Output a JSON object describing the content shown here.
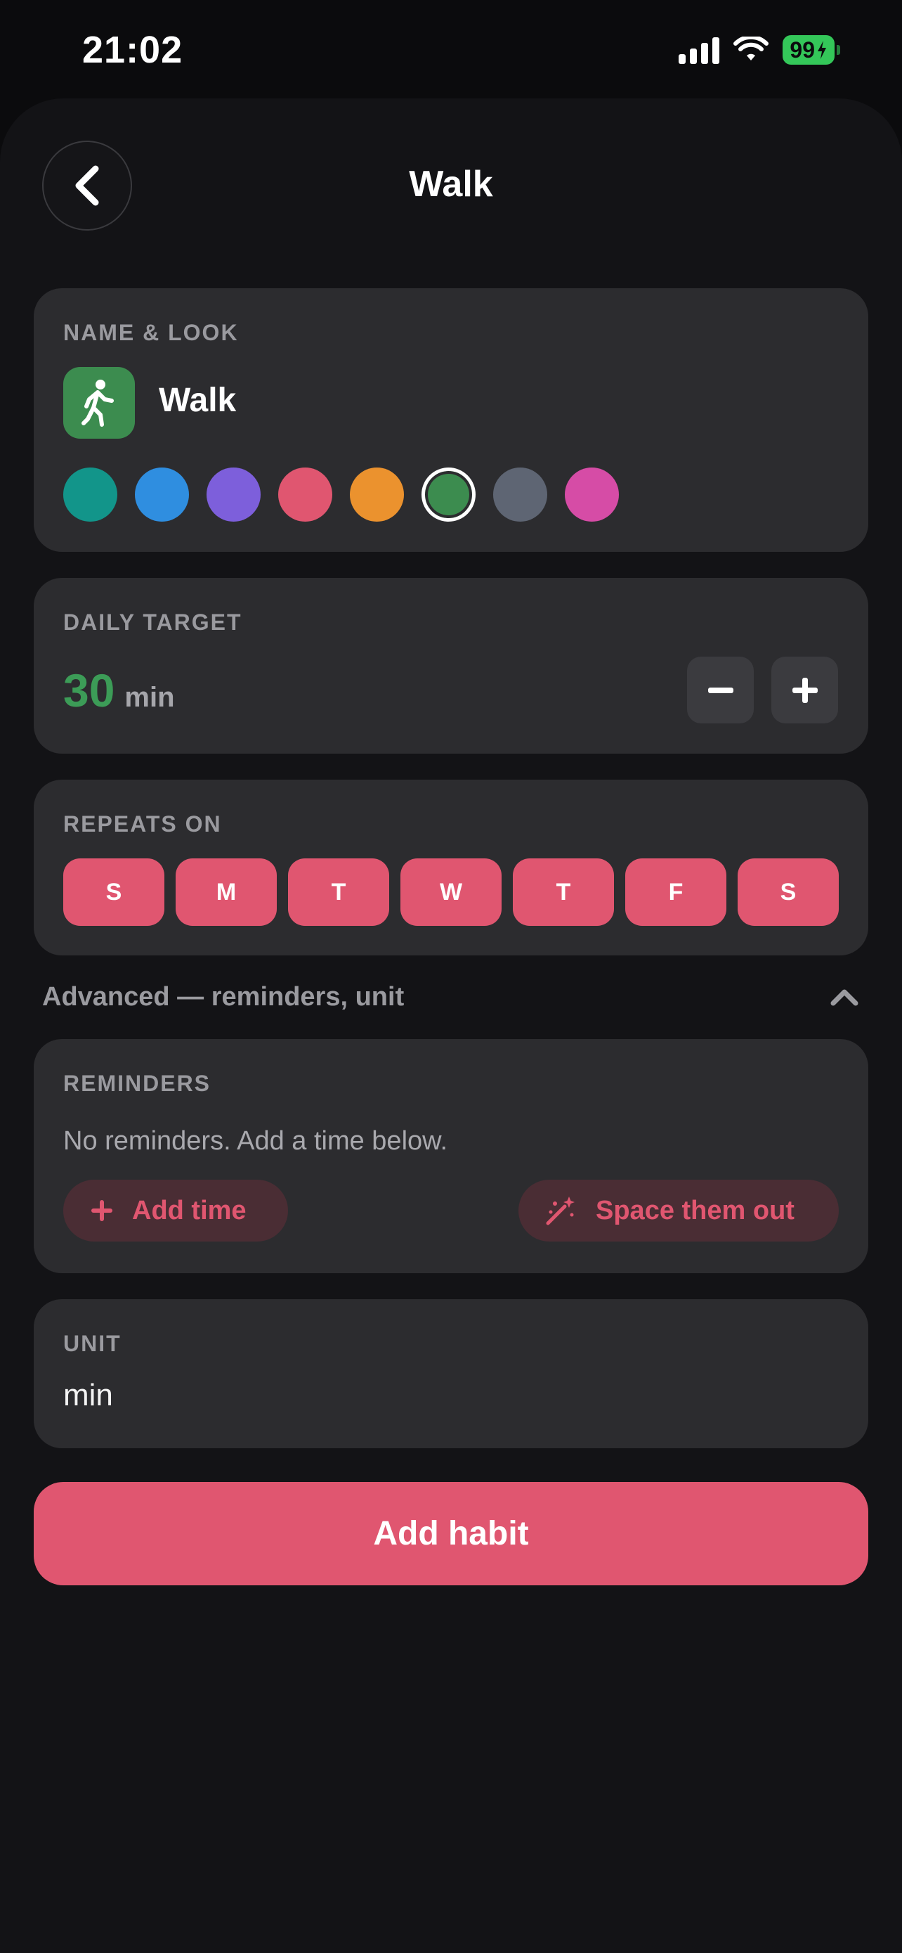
{
  "status_bar": {
    "time": "21:02",
    "battery": "99"
  },
  "header": {
    "title": "Walk"
  },
  "name_look": {
    "label": "NAME & LOOK",
    "habit_name": "Walk",
    "icon": "walking-person-icon",
    "colors": [
      "#12958a",
      "#2f8ee0",
      "#7d5fdb",
      "#e05670",
      "#eb922e",
      "#3c8c4f",
      "#5e6573",
      "#d64ca6"
    ],
    "selected_color": "#3c8c4f"
  },
  "daily_target": {
    "label": "DAILY TARGET",
    "value": "30",
    "unit": "min"
  },
  "repeats": {
    "label": "REPEATS ON",
    "days": [
      "S",
      "M",
      "T",
      "W",
      "T",
      "F",
      "S"
    ]
  },
  "advanced": {
    "label": "Advanced — reminders, unit"
  },
  "reminders": {
    "label": "REMINDERS",
    "empty_text": "No reminders. Add a time below.",
    "add_time_label": "Add time",
    "space_out_label": "Space them out"
  },
  "unit": {
    "label": "UNIT",
    "value": "min"
  },
  "primary_action": {
    "label": "Add habit"
  }
}
